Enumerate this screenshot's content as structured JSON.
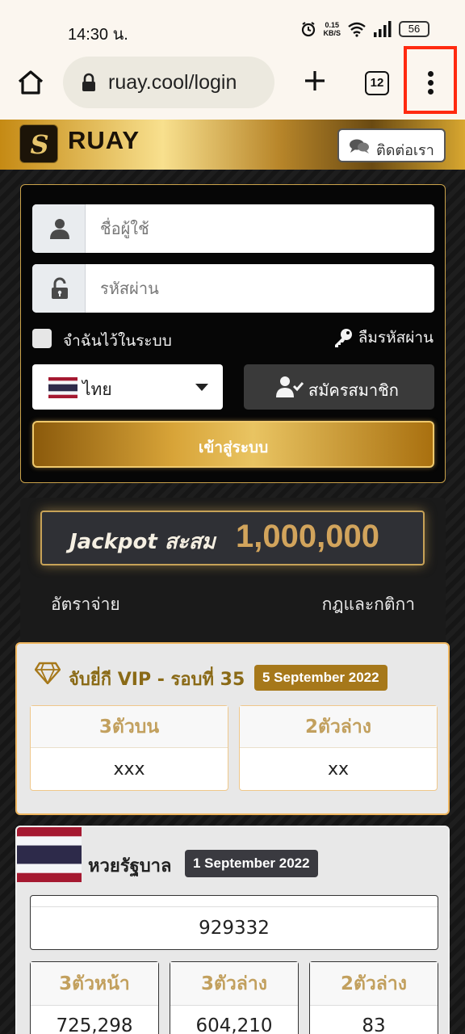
{
  "status": {
    "time": "14:30 น.",
    "speed_value": "0.15",
    "speed_unit": "KB/S",
    "battery": "56"
  },
  "browser": {
    "url": "ruay.cool/login",
    "tab_count": "12"
  },
  "header": {
    "logo_letter": "S",
    "brand": "RUAY",
    "contact_label": "ติดต่อเรา"
  },
  "login": {
    "username_placeholder": "ชื่อผู้ใช้",
    "password_placeholder": "รหัสผ่าน",
    "remember_label": "จำฉันไว้ในระบบ",
    "forgot_label": "ลืมรหัสผ่าน",
    "language": "ไทย",
    "register_label": "สมัครสมาชิก",
    "login_label": "เข้าสู่ระบบ"
  },
  "jackpot": {
    "label": "Jackpot สะสม",
    "value": "1,000,000",
    "rates_link": "อัตราจ่าย",
    "rules_link": "กฎและกติกา"
  },
  "vip": {
    "title": "จับยี่กี VIP - รอบที่ 35",
    "date": "5 September 2022",
    "columns": [
      {
        "label": "3ตัวบน",
        "value": "xxx"
      },
      {
        "label": "2ตัวล่าง",
        "value": "xx"
      }
    ]
  },
  "government": {
    "title": "หวยรัฐบาล",
    "date": "1 September 2022",
    "first_prize": "929332",
    "columns": [
      {
        "label": "3ตัวหน้า",
        "value": "725,298"
      },
      {
        "label": "3ตัวล่าง",
        "value": "604,210"
      },
      {
        "label": "2ตัวล่าง",
        "value": "83"
      }
    ]
  },
  "colors": {
    "accent_gold": "#c7a257",
    "highlight_red": "#ff2a10",
    "vip_date_bg": "#a6781a",
    "gov_date_bg": "#3a3a40"
  },
  "icons": [
    "alarm-icon",
    "wifi-icon",
    "signal-icon",
    "battery-icon",
    "home-icon",
    "lock-icon",
    "plus-icon",
    "tabs-icon",
    "more-vert-icon",
    "chat-icon",
    "user-icon",
    "unlock-icon",
    "key-icon",
    "flag-thailand-icon",
    "caret-down-icon",
    "user-check-icon",
    "diamond-icon"
  ]
}
